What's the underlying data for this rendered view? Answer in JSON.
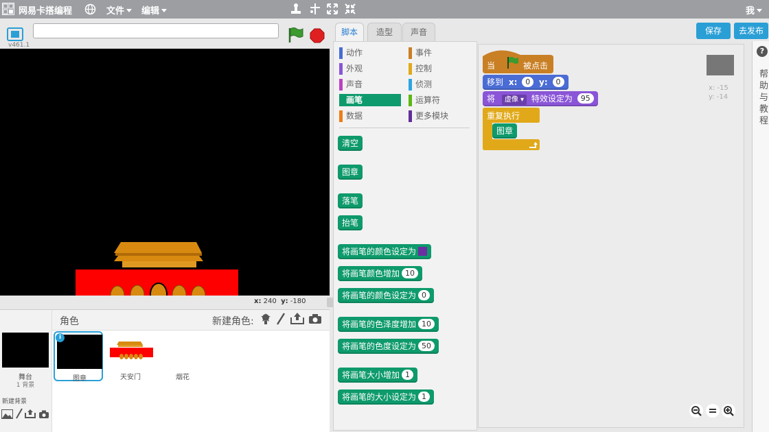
{
  "colors": {
    "topbar": "#9c9ea2",
    "accent": "#2a9fd6",
    "pen": "#0e9a6c",
    "events": "#c97f24",
    "motion": "#4a6cd4",
    "looks": "#8a55d7",
    "control": "#e1a91a"
  },
  "topbar": {
    "logo_text": "网易卡搭编程",
    "file_menu": "文件",
    "edit_menu": "编辑",
    "user": "我"
  },
  "stage": {
    "version": "v461.1",
    "project_title": "",
    "mouse_x_label": "x:",
    "mouse_x": "240",
    "mouse_y_label": "y:",
    "mouse_y": "-180"
  },
  "sprites": {
    "header_title": "角色",
    "new_sprite_label": "新建角色:",
    "stage_label": "舞台",
    "stage_sub": "1 背景",
    "new_backdrop_label": "新建背景",
    "items": [
      {
        "name": "图章"
      },
      {
        "name": "天安门"
      },
      {
        "name": "烟花"
      }
    ]
  },
  "tabs": [
    "脚本",
    "造型",
    "声音"
  ],
  "categories": [
    {
      "label": "动作",
      "color": "#4a6cd4"
    },
    {
      "label": "事件",
      "color": "#c97f24"
    },
    {
      "label": "外观",
      "color": "#8a55d7"
    },
    {
      "label": "控制",
      "color": "#e1a91a"
    },
    {
      "label": "声音",
      "color": "#bb42c3"
    },
    {
      "label": "侦测",
      "color": "#2ca5e2"
    },
    {
      "label": "画笔",
      "color": "#0e9a6c"
    },
    {
      "label": "运算符",
      "color": "#5cb712"
    },
    {
      "label": "数据",
      "color": "#ee7d16"
    },
    {
      "label": "更多模块",
      "color": "#632d99"
    }
  ],
  "palette_blocks": [
    {
      "label": "清空"
    },
    {
      "label": "图章"
    },
    {
      "label": "落笔"
    },
    {
      "label": "抬笔"
    },
    {
      "label": "将画笔的颜色设定为"
    },
    {
      "label": "将画笔颜色增加",
      "value": "10"
    },
    {
      "label": "将画笔的颜色设定为",
      "value": "0"
    },
    {
      "label": "将画笔的色泽度增加",
      "value": "10"
    },
    {
      "label": "将画笔的色度设定为",
      "value": "50"
    },
    {
      "label": "将画笔大小增加",
      "value": "1"
    },
    {
      "label": "将画笔的大小设定为",
      "value": "1"
    }
  ],
  "script": {
    "hat_when": "当",
    "hat_clicked": "被点击",
    "goto_label": "移到",
    "goto_x_label": "x:",
    "goto_x": "0",
    "goto_y_label": "y:",
    "goto_y": "0",
    "effect_prefix": "将",
    "effect_name": "虚像",
    "effect_suffix": "特效设定为",
    "effect_value": "95",
    "forever_label": "重复执行",
    "stamp_label": "图章",
    "sprite_x": "x: -15",
    "sprite_y": "y: -14"
  },
  "right": {
    "save": "保存",
    "share": "去发布",
    "help": "帮助与教程"
  }
}
